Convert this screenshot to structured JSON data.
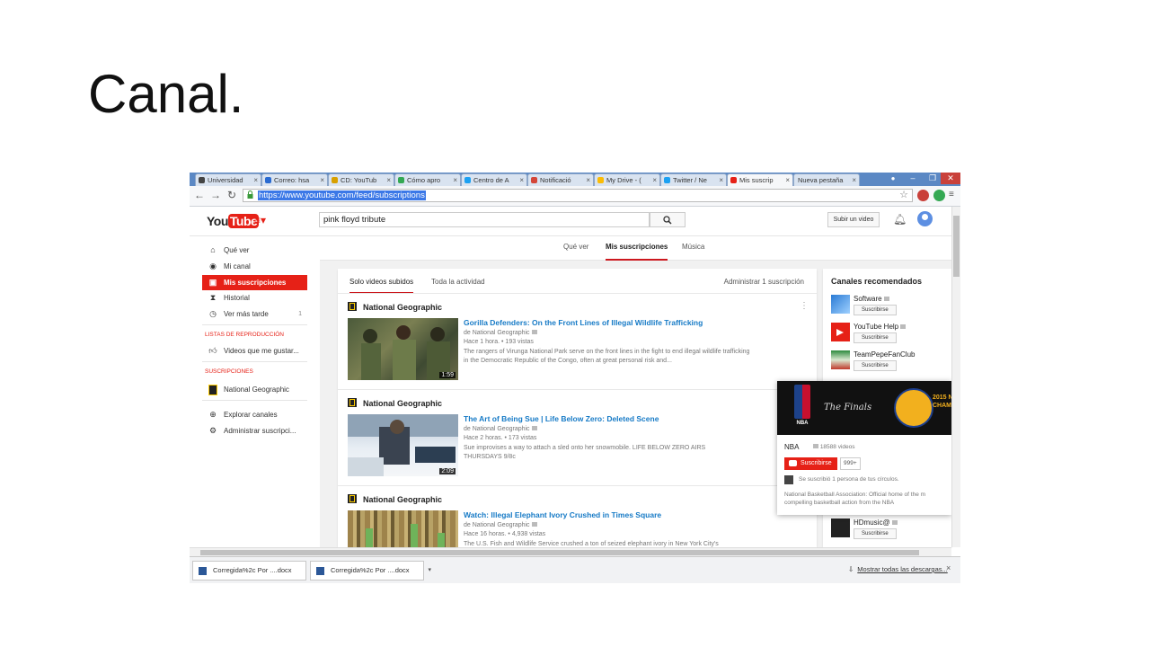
{
  "slide": {
    "title": "Canal."
  },
  "browser": {
    "tabs": [
      {
        "label": "Universidad",
        "color": "#444"
      },
      {
        "label": "Correo: hsa",
        "color": "#2a6bd1"
      },
      {
        "label": "CD: YouTub",
        "color": "#d8a000"
      },
      {
        "label": "Cómo apro",
        "color": "#34a853"
      },
      {
        "label": "Centro de A",
        "color": "#1da1f2"
      },
      {
        "label": "Notificació",
        "color": "#d44638"
      },
      {
        "label": "My Drive - (",
        "color": "#fbbc05"
      },
      {
        "label": "Twitter / Ne",
        "color": "#1da1f2"
      },
      {
        "label": "Mis suscrip",
        "color": "#e62117"
      },
      {
        "label": "Nueva pestaña",
        "color": "#ffffff"
      }
    ],
    "active_tab": 8,
    "url": "https://www.youtube.com/feed/subscriptions"
  },
  "youtube": {
    "logo_you": "You",
    "logo_tube": "Tube",
    "search_value": "pink floyd tribute",
    "upload_label": "Subir un video",
    "sidebar": {
      "items": [
        {
          "label": "Qué ver",
          "icon": "⌂"
        },
        {
          "label": "Mi canal",
          "icon": "◉"
        },
        {
          "label": "Mis suscripciones",
          "icon": "▣"
        },
        {
          "label": "Historial",
          "icon": "⧗"
        },
        {
          "label": "Ver más tarde",
          "icon": "◷",
          "count": "1"
        }
      ],
      "playlists_header": "LISTAS DE REPRODUCCIÓN",
      "playlist_item": "Videos que me gustar...",
      "subs_header": "SUSCRIPCIONES",
      "sub_item": "National Geographic",
      "explore": "Explorar canales",
      "manage": "Administrar suscripci..."
    },
    "top_tabs": [
      "Qué ver",
      "Mis suscripciones",
      "Música"
    ],
    "feed_tabs": [
      "Solo videos subidos",
      "Toda la actividad"
    ],
    "manage_subs": "Administrar 1 suscripción",
    "videos": [
      {
        "channel": "National Geographic",
        "title": "Gorilla Defenders: On the Front Lines of Illegal Wildlife Trafficking",
        "by": "de National Geographic",
        "meta": "Hace 1 hora. • 193 vistas",
        "desc": "The rangers of Virunga National Park serve on the front lines in the fight to end illegal wildlife trafficking in the Democratic Republic of the Congo, often at great personal risk and...",
        "duration": "1:59"
      },
      {
        "channel": "National Geographic",
        "title": "The Art of Being Sue | Life Below Zero: Deleted Scene",
        "by": "de National Geographic",
        "meta": "Hace 2 horas. • 173 vistas",
        "desc": "Sue improvises a way to attach a sled onto her snowmobile. LIFE BELOW ZERO AIRS THURSDAYS 9/8c",
        "duration": "2:09"
      },
      {
        "channel": "National Geographic",
        "title": "Watch: Illegal Elephant Ivory Crushed in Times Square",
        "by": "de National Geographic",
        "meta": "Hace 16 horas. • 4,938 vistas",
        "desc": "The U.S. Fish and Wildlife Service crushed a ton of seized elephant ivory in New York City's",
        "duration": ""
      }
    ],
    "recommended": {
      "title": "Canales recomendados",
      "subscribe_label": "Suscribirse",
      "channels": [
        {
          "name": "Software"
        },
        {
          "name": "YouTube Help"
        },
        {
          "name": "TeamPepeFanClub"
        },
        {
          "name": "HDmusic@"
        }
      ]
    },
    "nba_card": {
      "banner_logo": "NBA",
      "banner_finals": "The Finals",
      "banner_year": "2015 N CHAMP",
      "name": "NBA",
      "video_count": "18588 videos",
      "subscribe": "Suscribirse",
      "sub_count": "999+",
      "circles": "Se suscribió 1 persona de tus círculos.",
      "desc": "National Basketball Association: Official home of the m compelling basketball action from the NBA"
    }
  },
  "downloads": {
    "items": [
      "Corregida%2c Por ....docx",
      "Corregida%2c Por ....docx"
    ],
    "show_all": "Mostrar todas las descargas...",
    "close": "×"
  }
}
